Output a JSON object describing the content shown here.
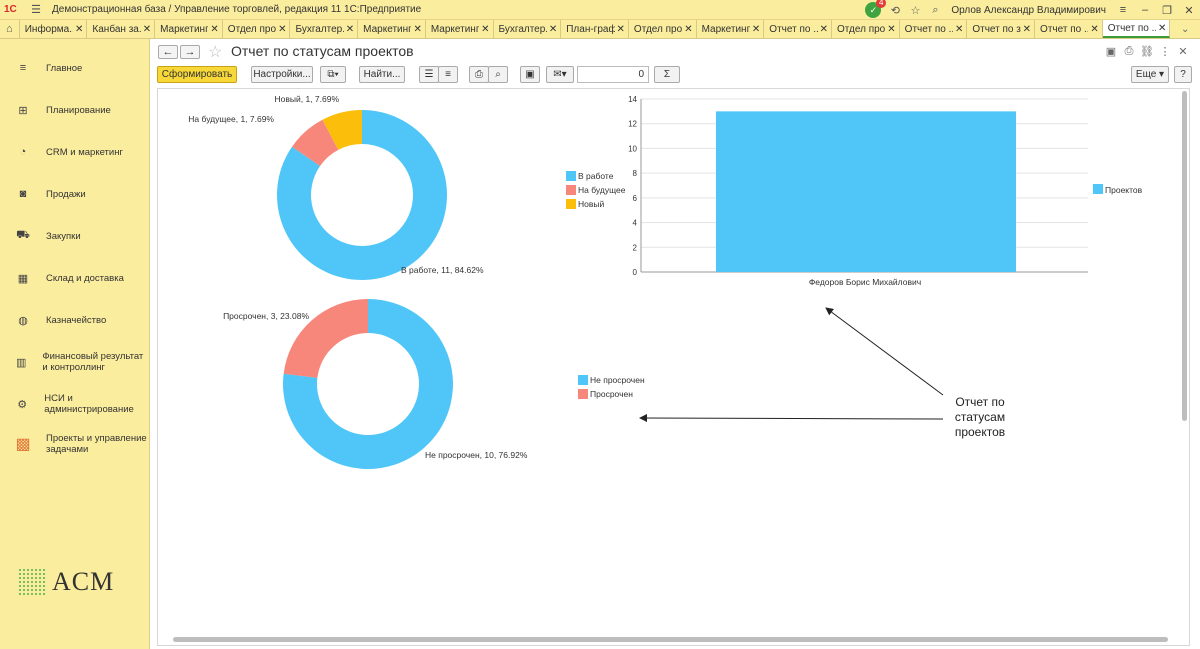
{
  "app": {
    "logo": "1С",
    "title": "Демонстрационная база / Управление торговлей, редакция 11 1С:Предприятие",
    "user": "Орлов Александр Владимирович",
    "notifications": "4"
  },
  "tabs": [
    {
      "label": "Информа..."
    },
    {
      "label": "Канбан за..."
    },
    {
      "label": "Маркетинг..."
    },
    {
      "label": "Отдел про..."
    },
    {
      "label": "Бухгалтер..."
    },
    {
      "label": "Маркетинг..."
    },
    {
      "label": "Маркетинг..."
    },
    {
      "label": "Бухгалтер..."
    },
    {
      "label": "План-граф..."
    },
    {
      "label": "Отдел про..."
    },
    {
      "label": "Маркетинг..."
    },
    {
      "label": "Отчет по ..."
    },
    {
      "label": "Отдел про..."
    },
    {
      "label": "Отчет по ..."
    },
    {
      "label": "Отчет по з..."
    },
    {
      "label": "Отчет по ..."
    },
    {
      "label": "Отчет по ..."
    }
  ],
  "sidebar": {
    "items": [
      {
        "label": "Главное",
        "icon": "menu-icon"
      },
      {
        "label": "Планирование",
        "icon": "planning-icon"
      },
      {
        "label": "CRM и маркетинг",
        "icon": "pie-icon"
      },
      {
        "label": "Продажи",
        "icon": "bag-icon"
      },
      {
        "label": "Закупки",
        "icon": "cart-icon"
      },
      {
        "label": "Склад и доставка",
        "icon": "warehouse-icon"
      },
      {
        "label": "Казначейство",
        "icon": "coin-icon"
      },
      {
        "label": "Финансовый результат и контроллинг",
        "icon": "chart-icon"
      },
      {
        "label": "НСИ и администрирование",
        "icon": "gear-icon"
      },
      {
        "label": "Проекты и управление задачами",
        "icon": "projects-icon"
      }
    ],
    "brand": "ACM"
  },
  "form": {
    "title": "Отчет по статусам проектов",
    "buttons": {
      "generate": "Сформировать",
      "settings": "Настройки...",
      "find": "Найти...",
      "more": "Еще",
      "help": "?"
    },
    "sum_value": "0",
    "sum_symbol": "Σ"
  },
  "chart_data": [
    {
      "type": "pie",
      "donut": true,
      "labels": [
        "В работе",
        "На будущее",
        "Новый"
      ],
      "values": [
        11,
        1,
        1
      ],
      "percents": [
        "84.62%",
        "7.69%",
        "7.69%"
      ],
      "colors": [
        "#4fc6f7",
        "#f6877a",
        "#fbbf0b"
      ],
      "data_labels": [
        "В работе, 11, 84.62%",
        "На будущее, 1, 7.69%",
        "Новый, 1, 7.69%"
      ],
      "legend": "right"
    },
    {
      "type": "bar",
      "categories": [
        "Федоров Борис Михайлович"
      ],
      "series": [
        {
          "name": "Проектов",
          "values": [
            13
          ],
          "color": "#4fc6f7"
        }
      ],
      "ylim": [
        0,
        14
      ],
      "yticks": [
        0,
        2,
        4,
        6,
        8,
        10,
        12,
        14
      ],
      "grid": true,
      "legend": "right"
    },
    {
      "type": "pie",
      "donut": true,
      "labels": [
        "Не просрочен",
        "Просрочен"
      ],
      "values": [
        10,
        3
      ],
      "percents": [
        "76.92%",
        "23.08%"
      ],
      "colors": [
        "#4fc6f7",
        "#f6877a"
      ],
      "data_labels": [
        "Не просрочен, 10, 76.92%",
        "Просрочен, 3, 23.08%"
      ],
      "legend": "right"
    }
  ],
  "annotation": {
    "lines": [
      "Отчет по",
      "статусам",
      "проектов"
    ]
  }
}
